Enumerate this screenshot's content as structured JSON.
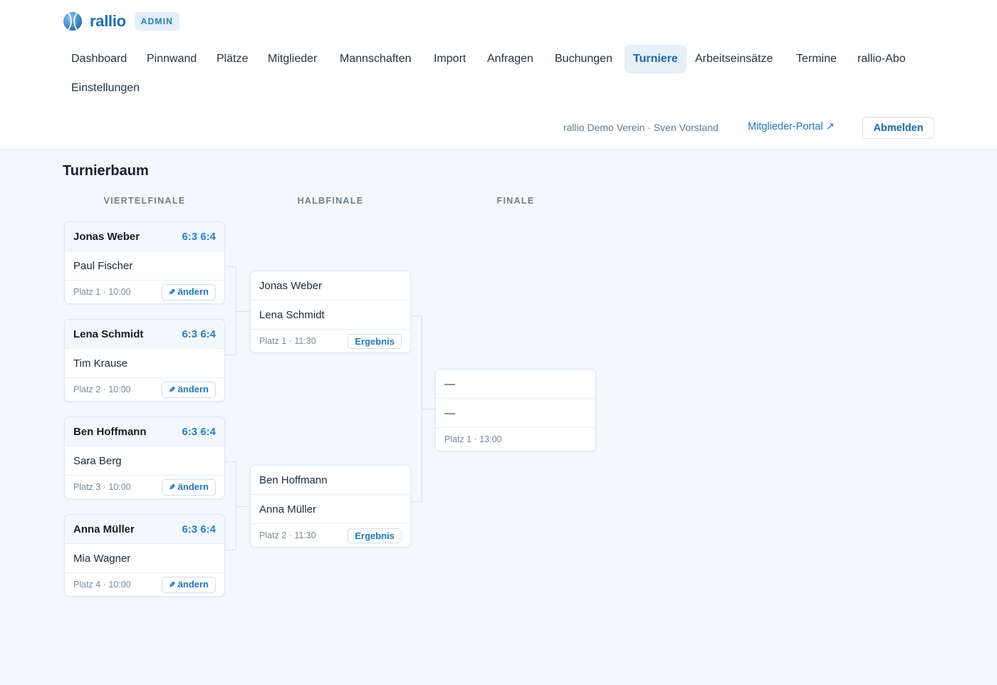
{
  "brand": {
    "name": "rallio",
    "badge": "ADMIN"
  },
  "nav": [
    {
      "id": "dashboard",
      "label": "Dashboard",
      "active": false
    },
    {
      "id": "pinnwand",
      "label": "Pinnwand",
      "active": false
    },
    {
      "id": "plaetze",
      "label": "Plätze",
      "active": false
    },
    {
      "id": "mitglieder",
      "label": "Mitglieder",
      "active": false
    },
    {
      "id": "mannschaften",
      "label": "Mannschaften",
      "active": false
    },
    {
      "id": "import",
      "label": "Import",
      "active": false
    },
    {
      "id": "anfragen",
      "label": "Anfragen",
      "active": false
    },
    {
      "id": "buchungen",
      "label": "Buchungen",
      "active": false
    },
    {
      "id": "turniere",
      "label": "Turniere",
      "active": true
    },
    {
      "id": "arbeitseinsaetze",
      "label": "Arbeitseinsätze",
      "active": false
    },
    {
      "id": "termine",
      "label": "Termine",
      "active": false
    },
    {
      "id": "abo",
      "label": "rallio-Abo",
      "active": false
    },
    {
      "id": "einstellungen",
      "label": "Einstellungen",
      "active": false
    }
  ],
  "account": {
    "club_user": "rallio Demo Verein · Sven Vorstand",
    "portal_label": "Mitglieder-Portal ↗",
    "logout_label": "Abmelden"
  },
  "bracket": {
    "title": "Turnierbaum",
    "rounds": [
      {
        "label": "VIERTELFINALE",
        "matches": [
          {
            "p1": "Jonas Weber",
            "p2": "Paul Fischer",
            "winner": 1,
            "score": "6:3 6:4",
            "info": "Platz 1 · 10:00",
            "action": "ändern"
          },
          {
            "p1": "Lena Schmidt",
            "p2": "Tim Krause",
            "winner": 1,
            "score": "6:3 6:4",
            "info": "Platz 2 · 10:00",
            "action": "ändern"
          },
          {
            "p1": "Ben Hoffmann",
            "p2": "Sara Berg",
            "winner": 1,
            "score": "6:3 6:4",
            "info": "Platz 3 · 10:00",
            "action": "ändern"
          },
          {
            "p1": "Anna Müller",
            "p2": "Mia Wagner",
            "winner": 1,
            "score": "6:3 6:4",
            "info": "Platz 4 · 10:00",
            "action": "ändern"
          }
        ]
      },
      {
        "label": "HALBFINALE",
        "matches": [
          {
            "p1": "Jonas Weber",
            "p2": "Lena Schmidt",
            "winner": 0,
            "score": "",
            "info": "Platz 1 · 11:30",
            "action": "Ergebnis"
          },
          {
            "p1": "Ben Hoffmann",
            "p2": "Anna Müller",
            "winner": 0,
            "score": "",
            "info": "Platz 2 · 11:30",
            "action": "Ergebnis"
          }
        ]
      },
      {
        "label": "FINALE",
        "matches": [
          {
            "p1": "—",
            "p2": "—",
            "winner": 0,
            "score": "",
            "info": "Platz 1 · 13:00",
            "action": ""
          }
        ]
      }
    ]
  },
  "colors": {
    "accent": "#1f78bd",
    "score": "#2580c3",
    "background": "#f3f8fc",
    "active_nav_bg": "#e5f0f9"
  }
}
